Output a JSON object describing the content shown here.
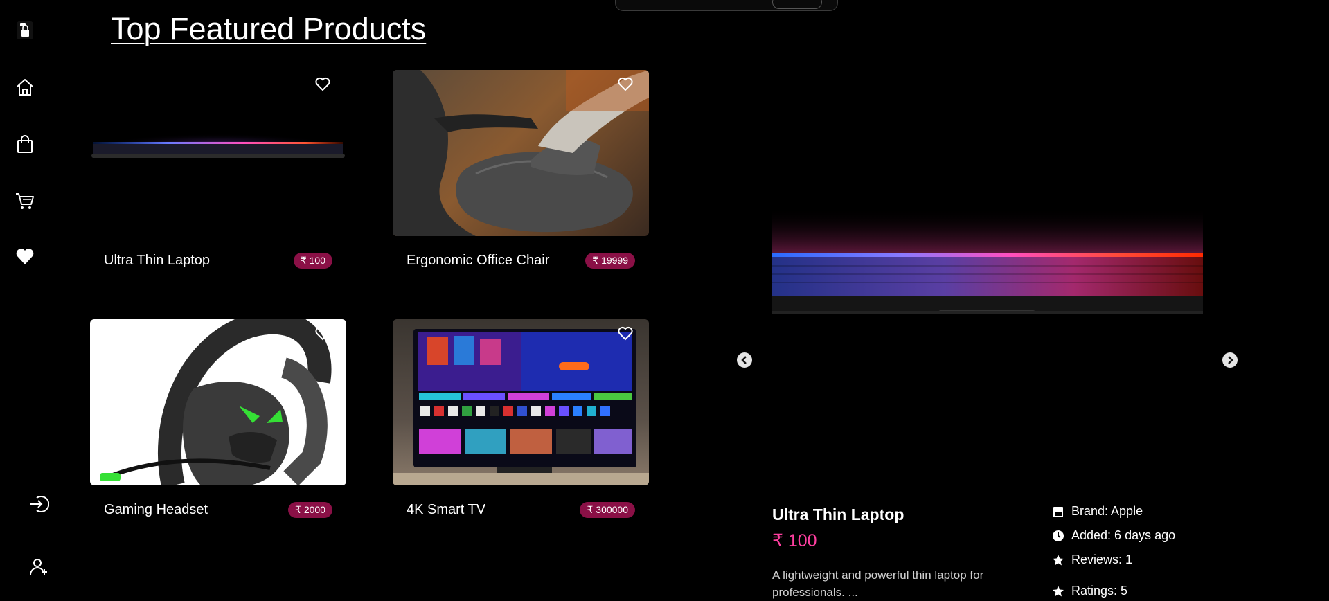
{
  "page": {
    "title": "Top Featured Products"
  },
  "sidebar": {
    "items": [
      {
        "icon": "logo-icon"
      },
      {
        "icon": "home-icon"
      },
      {
        "icon": "shopping-bag-icon"
      },
      {
        "icon": "cart-icon"
      },
      {
        "icon": "heart-icon"
      },
      {
        "icon": "login-icon"
      },
      {
        "icon": "user-add-icon"
      }
    ]
  },
  "products": [
    {
      "name": "Ultra Thin Laptop",
      "price": "₹ 100",
      "favorite_icon": "heart-outline-icon"
    },
    {
      "name": "Ergonomic Office Chair",
      "price": "₹ 19999",
      "favorite_icon": "heart-outline-icon"
    },
    {
      "name": "Gaming Headset",
      "price": "₹ 2000",
      "favorite_icon": "heart-outline-icon"
    },
    {
      "name": "4K Smart TV",
      "price": "₹ 300000",
      "favorite_icon": "heart-outline-icon"
    }
  ],
  "featured": {
    "name": "Ultra Thin Laptop",
    "price": "₹ 100",
    "description": "A lightweight and powerful thin laptop for professionals. ...",
    "brand": "Brand: Apple",
    "added": "Added: 6 days ago",
    "reviews": "Reviews: 1",
    "ratings": "Ratings: 5"
  },
  "colors": {
    "background": "#000000",
    "price_badge": "#8a1046",
    "accent_price": "#ff3fa0"
  }
}
